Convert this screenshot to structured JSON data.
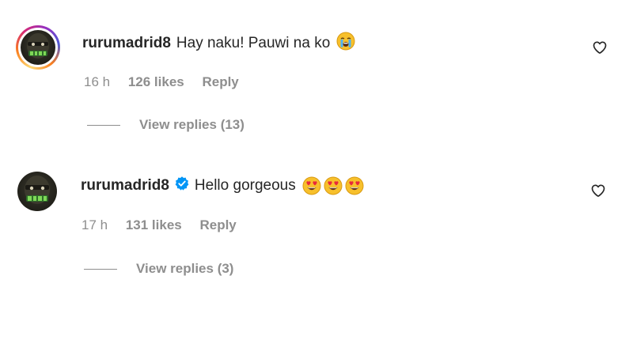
{
  "comments": [
    {
      "username": "rurumadrid8",
      "text": "Hay naku! Pauwi na ko",
      "emoji": "loudly-crying-face",
      "time": "16 h",
      "likes": "126 likes",
      "reply": "Reply",
      "view_replies": "View replies (13)",
      "has_story_ring": true,
      "verified": false
    },
    {
      "username": "rurumadrid8",
      "text": "Hello gorgeous",
      "emoji": "heart-eyes-face",
      "time": "17 h",
      "likes": "131 likes",
      "reply": "Reply",
      "view_replies": "View replies (3)",
      "has_story_ring": false,
      "verified": true
    }
  ],
  "colors": {
    "primary_text": "#262626",
    "secondary_text": "#8e8e8e",
    "verified_blue": "#0095f6",
    "emoji_yellow": "#f7c02b",
    "emoji_red_heart": "#e8283b"
  },
  "icons": {
    "like": "heart-outline-icon",
    "verified": "verified-badge-icon"
  }
}
